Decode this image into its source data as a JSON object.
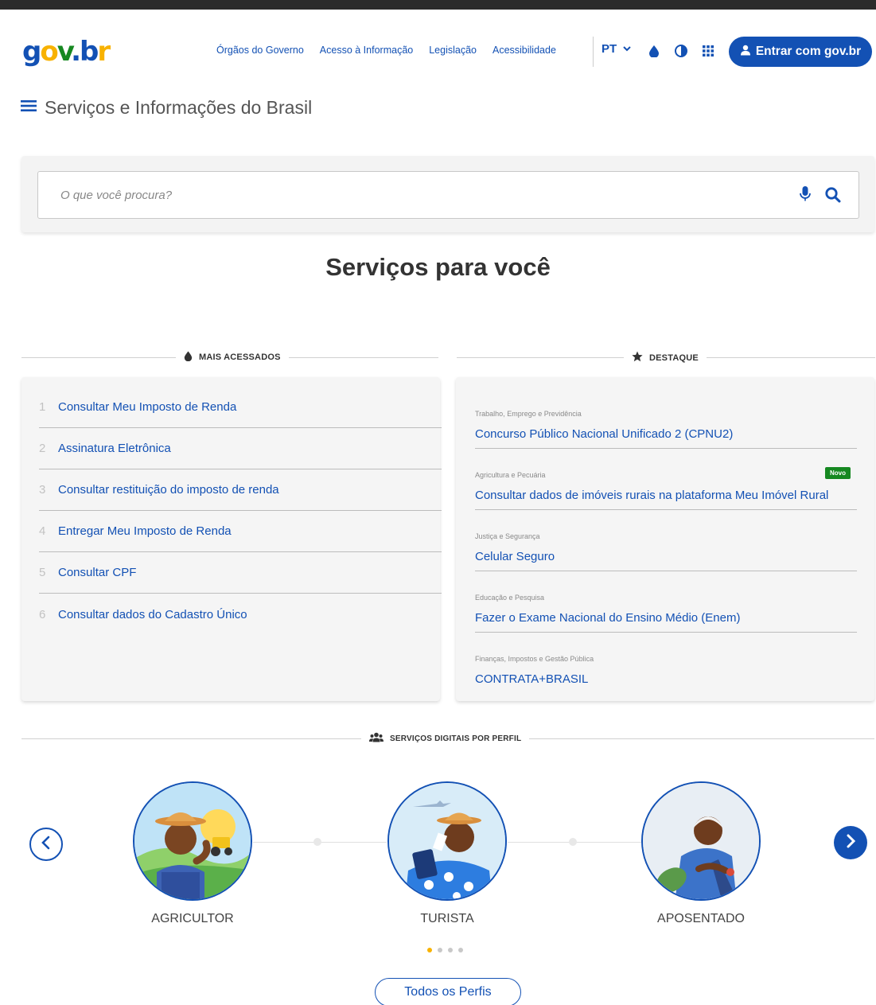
{
  "header": {
    "logo": {
      "g": "g",
      "o": "o",
      "v": "v",
      "dot": ".",
      "b": "b",
      "r": "r"
    },
    "nav": [
      "Órgãos do Governo",
      "Acesso à Informação",
      "Legislação",
      "Acessibilidade"
    ],
    "language": "PT",
    "icons": [
      "drop-icon",
      "contrast-icon",
      "apps-grid-icon"
    ],
    "login_label": "Entrar com gov.br"
  },
  "subheader": {
    "title": "Serviços e Informações do Brasil"
  },
  "search": {
    "placeholder": "O que você procura?"
  },
  "main": {
    "section_title": "Serviços para você",
    "mais_acessados": {
      "label": "MAIS ACESSADOS",
      "items": [
        {
          "num": "1",
          "label": "Consultar Meu Imposto de Renda"
        },
        {
          "num": "2",
          "label": "Assinatura Eletrônica"
        },
        {
          "num": "3",
          "label": "Consultar restituição do imposto de renda"
        },
        {
          "num": "4",
          "label": "Entregar Meu Imposto de Renda"
        },
        {
          "num": "5",
          "label": "Consultar CPF"
        },
        {
          "num": "6",
          "label": "Consultar dados do Cadastro Único"
        }
      ]
    },
    "destaque": {
      "label": "DESTAQUE",
      "items": [
        {
          "category": "Trabalho, Emprego e Previdência",
          "title": "Concurso Público Nacional Unificado 2 (CPNU2)",
          "badge": ""
        },
        {
          "category": "Agricultura e Pecuária",
          "title": "Consultar dados de imóveis rurais na plataforma Meu Imóvel Rural",
          "badge": "Novo"
        },
        {
          "category": "Justiça e Segurança",
          "title": "Celular Seguro",
          "badge": ""
        },
        {
          "category": "Educação e Pesquisa",
          "title": "Fazer o Exame Nacional do Ensino Médio (Enem)",
          "badge": ""
        },
        {
          "category": "Finanças, Impostos e Gestão Pública",
          "title": "CONTRATA+BRASIL",
          "badge": ""
        }
      ]
    },
    "perfis": {
      "label": "SERVIÇOS DIGITAIS POR PERFIL",
      "profiles": [
        {
          "label": "AGRICULTOR"
        },
        {
          "label": "TURISTA"
        },
        {
          "label": "APOSENTADO"
        }
      ],
      "page_count": 4,
      "active_page": 1,
      "all_button": "Todos os Perfis"
    }
  },
  "colors": {
    "primary": "#1351b4",
    "yellow": "#f8b200",
    "green": "#168821"
  }
}
